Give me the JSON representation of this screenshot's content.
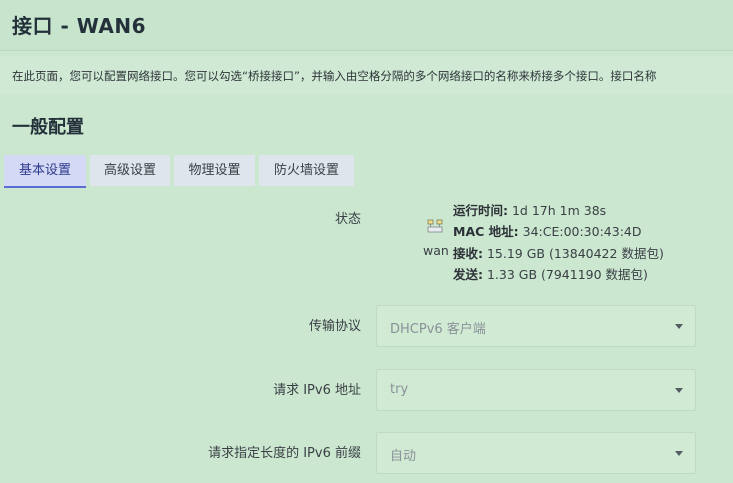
{
  "header": {
    "title": "接口 - WAN6"
  },
  "description": "在此页面，您可以配置网络接口。您可以勾选“桥接接口”，并输入由空格分隔的多个网络接口的名称来桥接多个接口。接口名称",
  "section": {
    "title": "一般配置"
  },
  "tabs": [
    {
      "label": "基本设置",
      "active": true
    },
    {
      "label": "高级设置",
      "active": false
    },
    {
      "label": "物理设置",
      "active": false
    },
    {
      "label": "防火墙设置",
      "active": false
    }
  ],
  "status": {
    "label": "状态",
    "interface": "wan",
    "icon": "network-port-icon",
    "lines": [
      {
        "key": "运行时间:",
        "value": " 1d 17h 1m 38s"
      },
      {
        "key": "MAC 地址:",
        "value": " 34:CE:00:30:43:4D"
      },
      {
        "key": "接收:",
        "value": " 15.19 GB (13840422 数据包)"
      },
      {
        "key": "发送:",
        "value": " 1.33 GB (7941190 数据包)"
      }
    ]
  },
  "fields": [
    {
      "label": "传输协议",
      "value": "DHCPv6 客户端"
    },
    {
      "label": "请求 IPv6 地址",
      "value": "try"
    },
    {
      "label": "请求指定长度的 IPv6 前缀",
      "value": "自动"
    }
  ]
}
